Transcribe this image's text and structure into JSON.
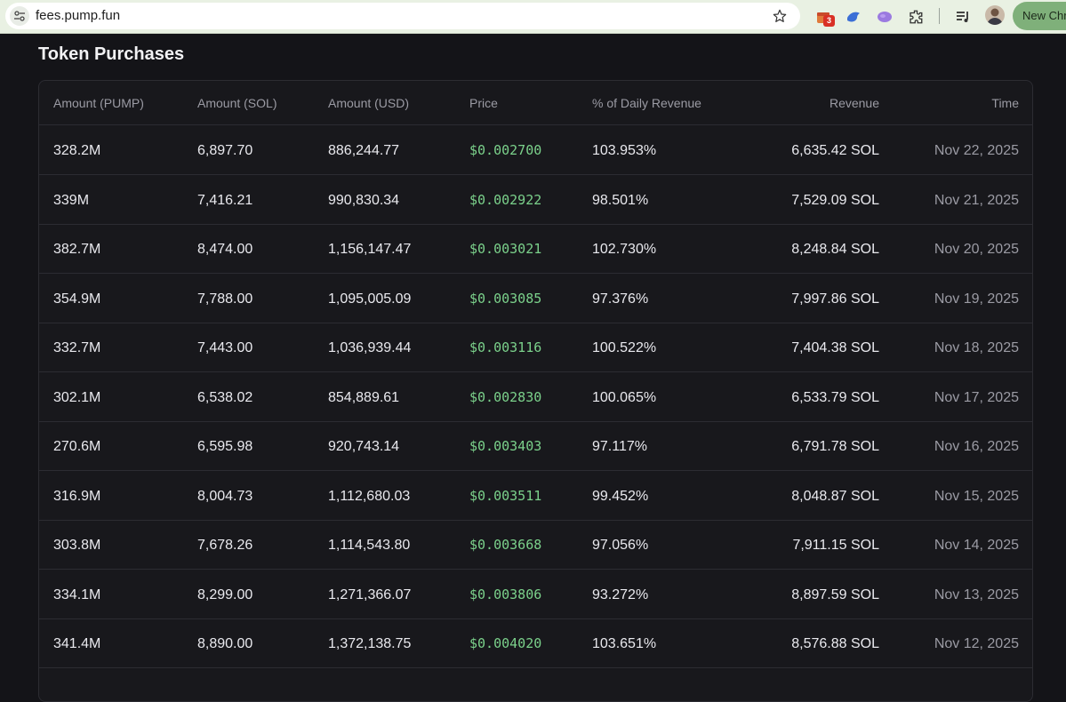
{
  "browser": {
    "url": "fees.pump.fun",
    "extension_badge": "3",
    "new_chrome_label": "New Chr"
  },
  "page": {
    "title": "Token Purchases"
  },
  "table": {
    "columns": [
      "Amount (PUMP)",
      "Amount (SOL)",
      "Amount (USD)",
      "Price",
      "% of Daily Revenue",
      "Revenue",
      "Time"
    ],
    "rows": [
      [
        "328.2M",
        "6,897.70",
        "886,244.77",
        "$0.002700",
        "103.953%",
        "6,635.42 SOL",
        "Nov 22, 2025"
      ],
      [
        "339M",
        "7,416.21",
        "990,830.34",
        "$0.002922",
        "98.501%",
        "7,529.09 SOL",
        "Nov 21, 2025"
      ],
      [
        "382.7M",
        "8,474.00",
        "1,156,147.47",
        "$0.003021",
        "102.730%",
        "8,248.84 SOL",
        "Nov 20, 2025"
      ],
      [
        "354.9M",
        "7,788.00",
        "1,095,005.09",
        "$0.003085",
        "97.376%",
        "7,997.86 SOL",
        "Nov 19, 2025"
      ],
      [
        "332.7M",
        "7,443.00",
        "1,036,939.44",
        "$0.003116",
        "100.522%",
        "7,404.38 SOL",
        "Nov 18, 2025"
      ],
      [
        "302.1M",
        "6,538.02",
        "854,889.61",
        "$0.002830",
        "100.065%",
        "6,533.79 SOL",
        "Nov 17, 2025"
      ],
      [
        "270.6M",
        "6,595.98",
        "920,743.14",
        "$0.003403",
        "97.117%",
        "6,791.78 SOL",
        "Nov 16, 2025"
      ],
      [
        "316.9M",
        "8,004.73",
        "1,112,680.03",
        "$0.003511",
        "99.452%",
        "8,048.87 SOL",
        "Nov 15, 2025"
      ],
      [
        "303.8M",
        "7,678.26",
        "1,114,543.80",
        "$0.003668",
        "97.056%",
        "7,911.15 SOL",
        "Nov 14, 2025"
      ],
      [
        "334.1M",
        "8,299.00",
        "1,271,366.07",
        "$0.003806",
        "93.272%",
        "8,897.59 SOL",
        "Nov 13, 2025"
      ],
      [
        "341.4M",
        "8,890.00",
        "1,372,138.75",
        "$0.004020",
        "103.651%",
        "8,576.88 SOL",
        "Nov 12, 2025"
      ]
    ]
  },
  "colors": {
    "background": "#141418",
    "price_green": "#7bd18b",
    "muted_text": "#9b9ba4"
  },
  "icons": [
    "site-info-icon",
    "bookmark-star-icon",
    "extension-gift-icon",
    "extension-bird-icon",
    "extension-brain-icon",
    "extensions-puzzle-icon",
    "media-queue-icon",
    "profile-avatar"
  ]
}
